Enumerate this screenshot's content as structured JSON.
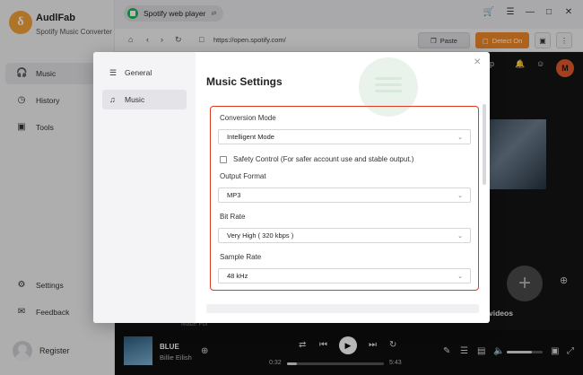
{
  "app": {
    "name": "AudlFab",
    "subtitle": "Spotify Music Converter",
    "logo_letter": "δ"
  },
  "sidebar": {
    "items": [
      {
        "label": "Music",
        "icon": "headphones-icon",
        "active": true
      },
      {
        "label": "History",
        "icon": "clock-icon",
        "active": false
      },
      {
        "label": "Tools",
        "icon": "toolbox-icon",
        "active": false
      }
    ],
    "bottom": [
      {
        "label": "Settings",
        "icon": "gear-icon"
      },
      {
        "label": "Feedback",
        "icon": "mail-icon"
      }
    ],
    "register_label": "Register"
  },
  "titlebar": {
    "tab_label": "Spotify web player",
    "switch_icon": "swap-icon"
  },
  "urlbar": {
    "url": "https://open.spotify.com/",
    "paste_label": "Paste",
    "detect_label": "Detect On"
  },
  "spotify": {
    "avatar_letter": "M",
    "videos_label": "videos",
    "made_for": "Made For"
  },
  "player": {
    "song": "BLUE",
    "artist": "Billie Eilish",
    "elapsed": "0:32",
    "duration": "5:43",
    "progress": 0.1,
    "volume": 0.7
  },
  "dialog": {
    "title": "Music Settings",
    "tabs": [
      {
        "label": "General",
        "icon": "sliders-icon",
        "active": false
      },
      {
        "label": "Music",
        "icon": "music-note-icon",
        "active": true
      }
    ],
    "fields": {
      "conversion_mode": {
        "label": "Conversion Mode",
        "value": "Intelligent Mode"
      },
      "safety_control": {
        "label": "Safety Control (For safer account use and stable output.)",
        "checked": false
      },
      "output_format": {
        "label": "Output Format",
        "value": "MP3"
      },
      "bit_rate": {
        "label": "Bit Rate",
        "value": "Very High ( 320 kbps )"
      },
      "sample_rate": {
        "label": "Sample Rate",
        "value": "48 kHz"
      }
    }
  },
  "colors": {
    "accent_orange": "#f08a2a",
    "highlight_red": "#e0391c",
    "spotify_green": "#1db954"
  }
}
